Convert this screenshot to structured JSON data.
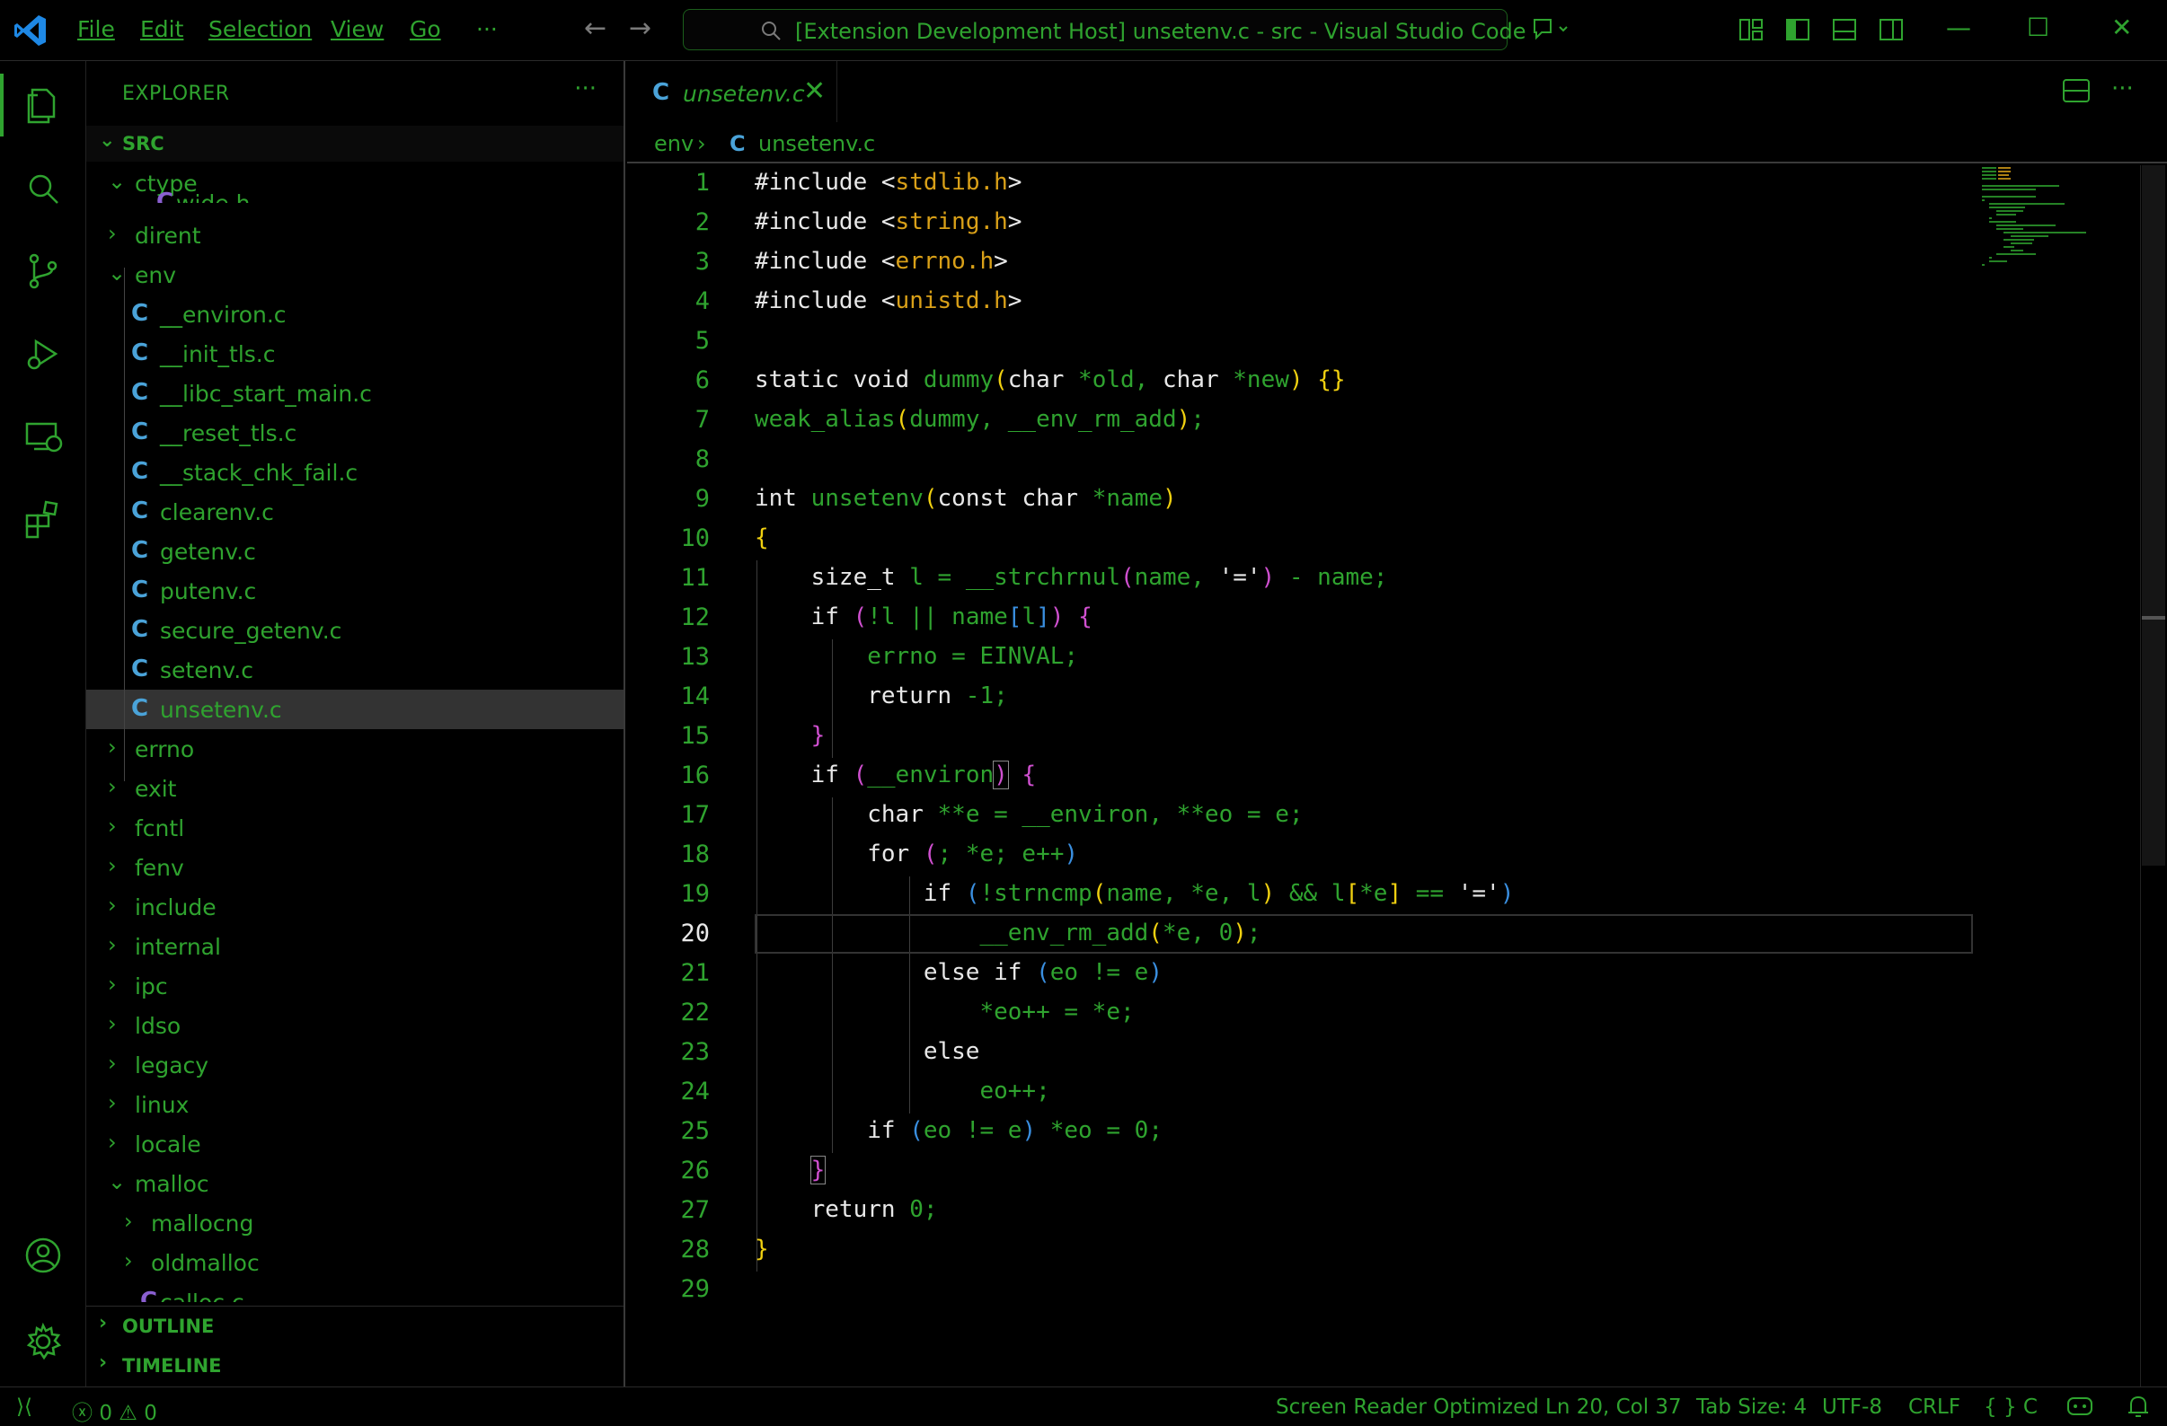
{
  "window": {
    "title": "[Extension Development Host] unsetenv.c - src - Visual Studio Code",
    "menu": [
      "File",
      "Edit",
      "Selection",
      "View",
      "Go",
      "···"
    ]
  },
  "colors": {
    "accent": "#2fa32f",
    "background": "#000000",
    "keyword": "#e8e8e8",
    "string": "#d9a018",
    "bracket_yellow": "#f0d010",
    "bracket_pink": "#d050d0",
    "bracket_blue": "#3a8fe0",
    "file_icon": "#4aa3d9"
  },
  "activity_bar": {
    "icons": [
      "explorer-icon",
      "search-icon",
      "source-control-icon",
      "run-debug-icon",
      "remote-explorer-icon",
      "extensions-icon",
      "account-icon",
      "settings-gear-icon"
    ]
  },
  "sidebar": {
    "header": "EXPLORER",
    "more": "···",
    "root": "SRC",
    "items": [
      {
        "label": "ctype",
        "type": "folder",
        "expanded": true
      },
      {
        "label": "wide.h",
        "type": "file-partial"
      },
      {
        "label": "dirent",
        "type": "folder"
      },
      {
        "label": "env",
        "type": "folder",
        "expanded": true
      },
      {
        "label": "__environ.c",
        "type": "file"
      },
      {
        "label": "__init_tls.c",
        "type": "file"
      },
      {
        "label": "__libc_start_main.c",
        "type": "file"
      },
      {
        "label": "__reset_tls.c",
        "type": "file"
      },
      {
        "label": "__stack_chk_fail.c",
        "type": "file"
      },
      {
        "label": "clearenv.c",
        "type": "file"
      },
      {
        "label": "getenv.c",
        "type": "file"
      },
      {
        "label": "putenv.c",
        "type": "file"
      },
      {
        "label": "secure_getenv.c",
        "type": "file"
      },
      {
        "label": "setenv.c",
        "type": "file"
      },
      {
        "label": "unsetenv.c",
        "type": "file",
        "selected": true
      },
      {
        "label": "errno",
        "type": "folder"
      },
      {
        "label": "exit",
        "type": "folder"
      },
      {
        "label": "fcntl",
        "type": "folder"
      },
      {
        "label": "fenv",
        "type": "folder"
      },
      {
        "label": "include",
        "type": "folder"
      },
      {
        "label": "internal",
        "type": "folder"
      },
      {
        "label": "ipc",
        "type": "folder"
      },
      {
        "label": "ldso",
        "type": "folder"
      },
      {
        "label": "legacy",
        "type": "folder"
      },
      {
        "label": "linux",
        "type": "folder"
      },
      {
        "label": "locale",
        "type": "folder"
      },
      {
        "label": "malloc",
        "type": "folder",
        "expanded": true
      },
      {
        "label": "mallocng",
        "type": "folder"
      },
      {
        "label": "oldmalloc",
        "type": "folder"
      },
      {
        "label": "calloc.c",
        "type": "file-partial"
      }
    ],
    "outline": "OUTLINE",
    "timeline": "TIMELINE"
  },
  "editor": {
    "tab": {
      "label": "unsetenv.c",
      "icon": "C",
      "close": "✕"
    },
    "breadcrumb": {
      "folder": "env",
      "separator": "›",
      "file": "unsetenv.c",
      "icon": "C"
    },
    "current_line": 20,
    "lines": [
      "#include <stdlib.h>",
      "#include <string.h>",
      "#include <errno.h>",
      "#include <unistd.h>",
      "",
      "static void dummy(char *old, char *new) {}",
      "weak_alias(dummy, __env_rm_add);",
      "",
      "int unsetenv(const char *name)",
      "{",
      "    size_t l = __strchrnul(name, '=') - name;",
      "    if (!l || name[l]) {",
      "        errno = EINVAL;",
      "        return -1;",
      "    }",
      "    if (__environ) {",
      "        char **e = __environ, **eo = e;",
      "        for (; *e; e++)",
      "            if (!strncmp(name, *e, l) && l[*e] == '=')",
      "                __env_rm_add(*e, 0);",
      "            else if (eo != e)",
      "                *eo++ = *e;",
      "            else",
      "                eo++;",
      "        if (eo != e) *eo = 0;",
      "    }",
      "    return 0;",
      "}",
      ""
    ]
  },
  "status_bar": {
    "remote": "⟩⟨",
    "errors": "0",
    "warnings": "0",
    "screen_reader": "Screen Reader Optimized",
    "position": "Ln 20, Col 37",
    "tab_size": "Tab Size: 4",
    "encoding": "UTF-8",
    "eol": "CRLF",
    "language": "{ } C"
  }
}
